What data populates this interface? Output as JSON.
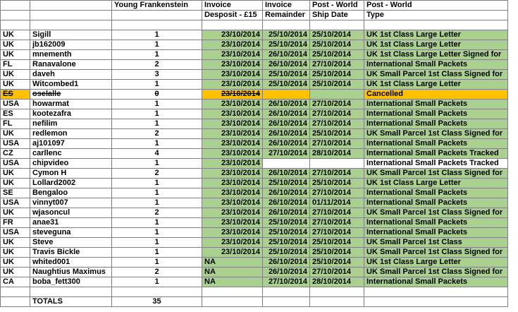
{
  "headers": {
    "row1": [
      "",
      "",
      "Young Frankenstein",
      "Invoice",
      "Invoice",
      "Post - World",
      "Post - World"
    ],
    "row2": [
      "",
      "",
      "",
      "Desposit - £15",
      "Remainder",
      "Ship Date",
      "Type"
    ]
  },
  "rows": [
    {
      "country": "UK",
      "user": "Sigill",
      "qty": "1",
      "deposit": "23/10/2014",
      "remainder": "25/10/2014",
      "ship": "25/10/2014",
      "type": "UK 1st Class Large Letter",
      "style": "green"
    },
    {
      "country": "UK",
      "user": "jb162009",
      "qty": "1",
      "deposit": "23/10/2014",
      "remainder": "25/10/2014",
      "ship": "25/10/2014",
      "type": "UK 1st Class Large Letter",
      "style": "green"
    },
    {
      "country": "UK",
      "user": "mnementh",
      "qty": "1",
      "deposit": "23/10/2014",
      "remainder": "26/10/2014",
      "ship": "25/10/2014",
      "type": "UK 1st Class Large Letter Signed for",
      "style": "green"
    },
    {
      "country": "FL",
      "user": "Ranavalone",
      "qty": "2",
      "deposit": "23/10/2014",
      "remainder": "26/10/2014",
      "ship": "27/10/2014",
      "type": "International Small Packets",
      "style": "green"
    },
    {
      "country": "UK",
      "user": "daveh",
      "qty": "3",
      "deposit": "23/10/2014",
      "remainder": "25/10/2014",
      "ship": "25/10/2014",
      "type": "UK Small Parcel 1st Class Signed for",
      "style": "green"
    },
    {
      "country": "UK",
      "user": "Witcombed1",
      "qty": "1",
      "deposit": "23/10/2014",
      "remainder": "25/10/2014",
      "ship": "25/10/2014",
      "type": "UK 1st Class Large Letter",
      "style": "green"
    },
    {
      "country": "ES",
      "user": "oselalle",
      "qty": "0",
      "deposit": "23/10/2014",
      "remainder": "",
      "ship": "",
      "type": "Cancelled",
      "style": "orange"
    },
    {
      "country": "USA",
      "user": "howarmat",
      "qty": "1",
      "deposit": "23/10/2014",
      "remainder": "26/10/2014",
      "ship": "27/10/2014",
      "type": "International Small Packets",
      "style": "green"
    },
    {
      "country": "ES",
      "user": "kootezafra",
      "qty": "1",
      "deposit": "23/10/2014",
      "remainder": "26/10/2014",
      "ship": "27/10/2014",
      "type": "International Small Packets",
      "style": "green"
    },
    {
      "country": "FL",
      "user": "nefilim",
      "qty": "1",
      "deposit": "23/10/2014",
      "remainder": "26/10/2014",
      "ship": "27/10/2014",
      "type": "International Small Packets",
      "style": "green"
    },
    {
      "country": "UK",
      "user": "redlemon",
      "qty": "2",
      "deposit": "23/10/2014",
      "remainder": "26/10/2014",
      "ship": "25/10/2014",
      "type": "UK Small Parcel 1st Class Signed for",
      "style": "green"
    },
    {
      "country": "USA",
      "user": "aj101097",
      "qty": "1",
      "deposit": "23/10/2014",
      "remainder": "26/10/2014",
      "ship": "27/10/2014",
      "type": "International Small Packets",
      "style": "green"
    },
    {
      "country": "CZ",
      "user": "carllenc",
      "qty": "4",
      "deposit": "23/10/2014",
      "remainder": "27/10/2014",
      "ship": "28/10/2014",
      "type": "International Small Packets Tracked",
      "style": "green"
    },
    {
      "country": "USA",
      "user": "chipvideo",
      "qty": "1",
      "deposit": "23/10/2014",
      "remainder": "",
      "ship": "",
      "type": "International Small Packets Tracked",
      "style": "partial"
    },
    {
      "country": "UK",
      "user": "Cymon H",
      "qty": "2",
      "deposit": "23/10/2014",
      "remainder": "26/10/2014",
      "ship": "27/10/2014",
      "type": "UK Small Parcel 1st Class Signed for",
      "style": "green"
    },
    {
      "country": "UK",
      "user": "Lollard2002",
      "qty": "1",
      "deposit": "23/10/2014",
      "remainder": "25/10/2014",
      "ship": "25/10/2014",
      "type": "UK 1st Class Large Letter",
      "style": "green"
    },
    {
      "country": "SE",
      "user": "Bengaloo",
      "qty": "1",
      "deposit": "23/10/2014",
      "remainder": "26/10/2014",
      "ship": "27/10/2014",
      "type": "International Small Packets",
      "style": "green"
    },
    {
      "country": "USA",
      "user": "vinnyt007",
      "qty": "1",
      "deposit": "23/10/2014",
      "remainder": "26/10/2014",
      "ship": "01/11/2014",
      "type": "International Small Packets",
      "style": "green"
    },
    {
      "country": "UK",
      "user": "wjasoncul",
      "qty": "2",
      "deposit": "23/10/2014",
      "remainder": "26/10/2014",
      "ship": "27/10/2014",
      "type": "UK Small Parcel 1st Class Signed for",
      "style": "green"
    },
    {
      "country": "FR",
      "user": "anae31",
      "qty": "1",
      "deposit": "23/10/2014",
      "remainder": "25/10/2014",
      "ship": "27/10/2014",
      "type": "International Small Packets",
      "style": "green"
    },
    {
      "country": "USA",
      "user": "steveguna",
      "qty": "1",
      "deposit": "23/10/2014",
      "remainder": "25/10/2014",
      "ship": "27/10/2014",
      "type": "International Small Packets",
      "style": "green"
    },
    {
      "country": "UK",
      "user": "Steve",
      "qty": "1",
      "deposit": "23/10/2014",
      "remainder": "25/10/2014",
      "ship": "25/10/2014",
      "type": "UK Small Parcel 1st Class",
      "style": "green"
    },
    {
      "country": "UK",
      "user": "Travis Bickle",
      "qty": "1",
      "deposit": "23/10/2014",
      "remainder": "25/10/2014",
      "ship": "25/10/2014",
      "type": "UK Small Parcel 1st Class Signed for",
      "style": "green"
    },
    {
      "country": "UK",
      "user": "whited001",
      "qty": "1",
      "deposit": "NA",
      "remainder": "26/10/2014",
      "ship": "25/10/2014",
      "type": "UK 1st Class Large Letter",
      "style": "green-na"
    },
    {
      "country": "UK",
      "user": "Naughtius Maximus",
      "qty": "2",
      "deposit": "NA",
      "remainder": "26/10/2014",
      "ship": "27/10/2014",
      "type": "UK Small Parcel 1st Class Signed for",
      "style": "green-na"
    },
    {
      "country": "CA",
      "user": "boba_fett300",
      "qty": "1",
      "deposit": "NA",
      "remainder": "27/10/2014",
      "ship": "28/10/2014",
      "type": "International Small Packets",
      "style": "green-na"
    }
  ],
  "totals": {
    "label": "TOTALS",
    "value": "35"
  }
}
